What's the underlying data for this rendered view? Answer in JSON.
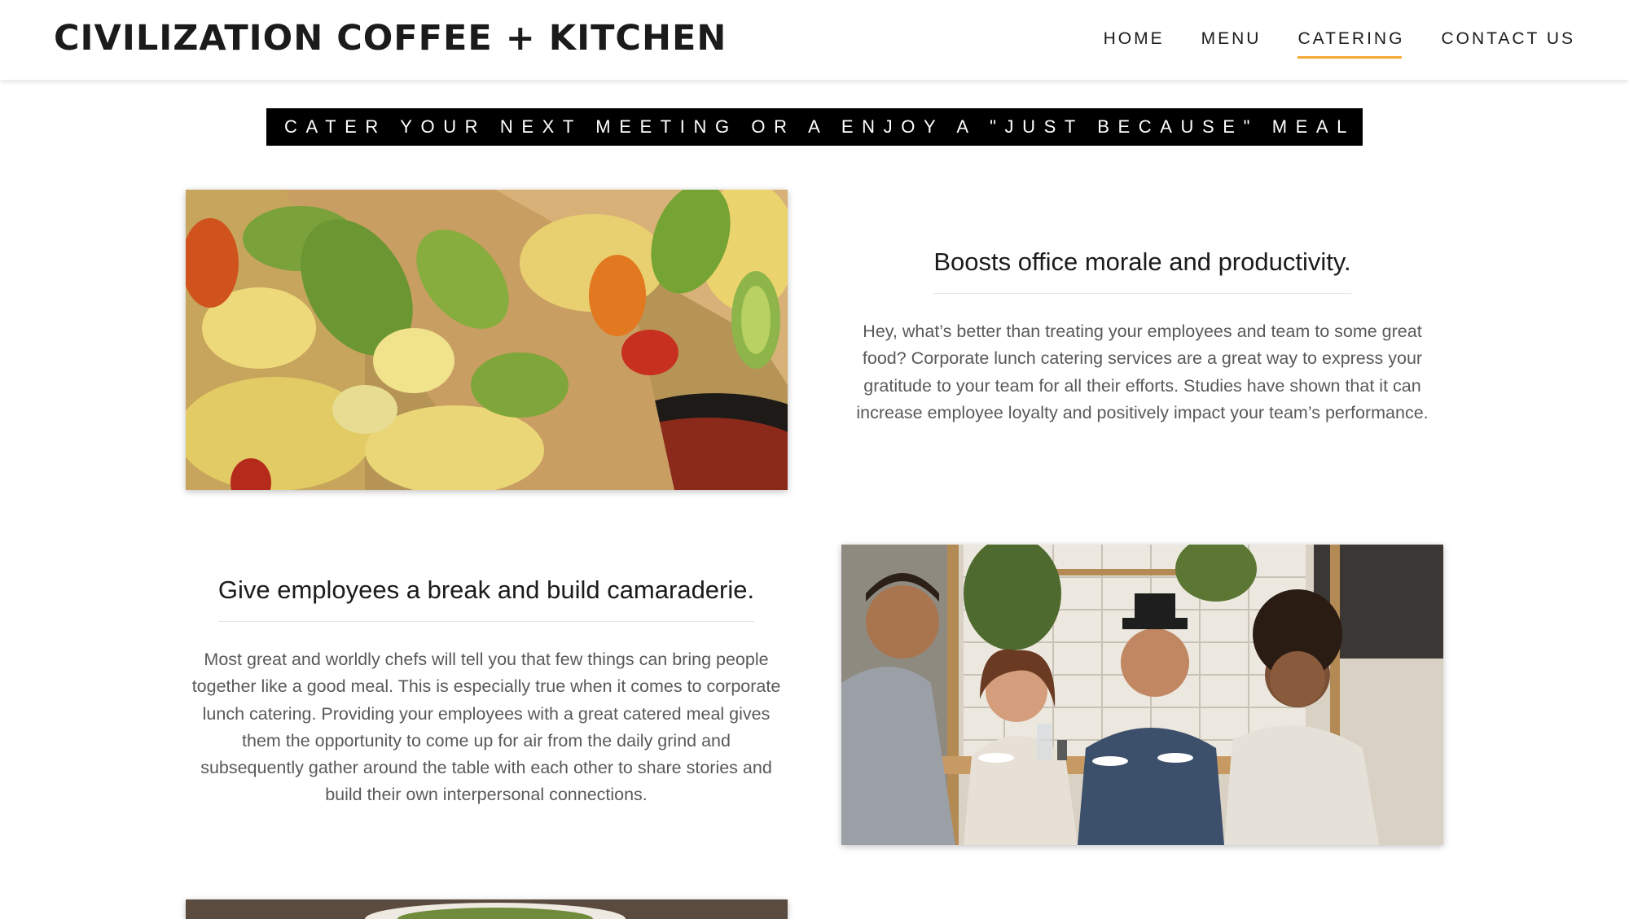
{
  "header": {
    "brand": "CIVILIZATION COFFEE + KITCHEN",
    "nav": [
      {
        "label": "HOME",
        "active": false
      },
      {
        "label": "MENU",
        "active": false
      },
      {
        "label": "CATERING",
        "active": true
      },
      {
        "label": "CONTACT US",
        "active": false
      }
    ]
  },
  "tagline": "CATER YOUR NEXT MEETING OR A ENJOY A \"JUST BECAUSE\" MEAL",
  "features": [
    {
      "title": "Boosts office morale and productivity.",
      "lines": [
        "Hey, what’s better than treating your employees and team to some great",
        "food? Corporate lunch catering services are a great way to express your",
        "gratitude to your team for all their efforts. Studies have shown that it can",
        "increase employee loyalty and positively impact your team’s performance."
      ]
    },
    {
      "title": "Give employees a break and build camaraderie.",
      "lines": [
        "Most great and worldly chefs will tell you that few things can bring people",
        "together like a good meal. This is especially true when it comes to corporate",
        "lunch catering. Providing your employees with a great catered meal gives",
        "them the opportunity to come up for air from the daily grind and",
        "subsequently gather around the table with each other to share stories and",
        "build their own interpersonal connections."
      ]
    }
  ],
  "colors": {
    "accent": "#f4a836",
    "tagline_bg": "#000000",
    "body_text": "#595959"
  }
}
